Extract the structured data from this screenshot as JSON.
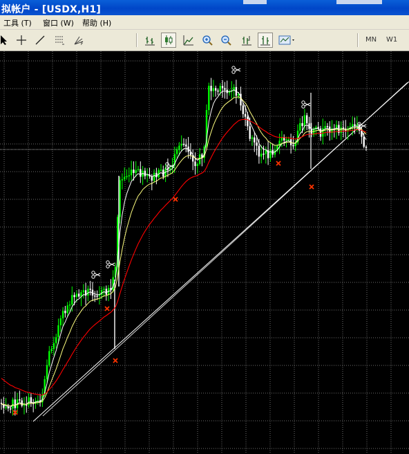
{
  "window": {
    "title": "拟帐户 - [USDX,H1]"
  },
  "menu": [
    {
      "label": "工具 (T)"
    },
    {
      "label": "窗口 (W)"
    },
    {
      "label": "帮助 (H)"
    }
  ],
  "toolbar": {
    "tools": [
      {
        "icon": "cursor-icon"
      },
      {
        "icon": "crosshair-icon"
      },
      {
        "icon": "trendline-icon"
      },
      {
        "icon": "fibonacci-icon"
      },
      {
        "icon": "fibonacci-fan-icon"
      },
      {
        "icon": "bar-chart-icon"
      },
      {
        "icon": "candlestick-icon"
      },
      {
        "icon": "line-chart-icon"
      },
      {
        "icon": "zoom-in-icon"
      },
      {
        "icon": "zoom-out-icon"
      },
      {
        "icon": "chart-shift-icon"
      },
      {
        "icon": "autoscroll-icon"
      },
      {
        "icon": "templates-icon"
      }
    ],
    "timeframes": [
      "MN",
      "W1"
    ]
  },
  "chart_data": {
    "type": "candlestick",
    "symbol": "USDX",
    "timeframe": "H1",
    "theme": {
      "background": "#000000",
      "grid": "#6e6e6e",
      "bull": "#00ff00",
      "bear": "#ffffff",
      "ma_fast": "#ffffff",
      "ma_mid": "#ffff80",
      "ma_slow": "#ff0000",
      "trendline": "#ffffff",
      "marker": "#ff3300"
    },
    "grid": true,
    "price_line": "horizontal dotted",
    "trendlines": "rising white line",
    "moving_averages": [
      "fast (white)",
      "medium (yellow)",
      "slow (red)"
    ],
    "markers": [
      "scissors icons at local highs",
      "red crosses at local lows"
    ]
  }
}
